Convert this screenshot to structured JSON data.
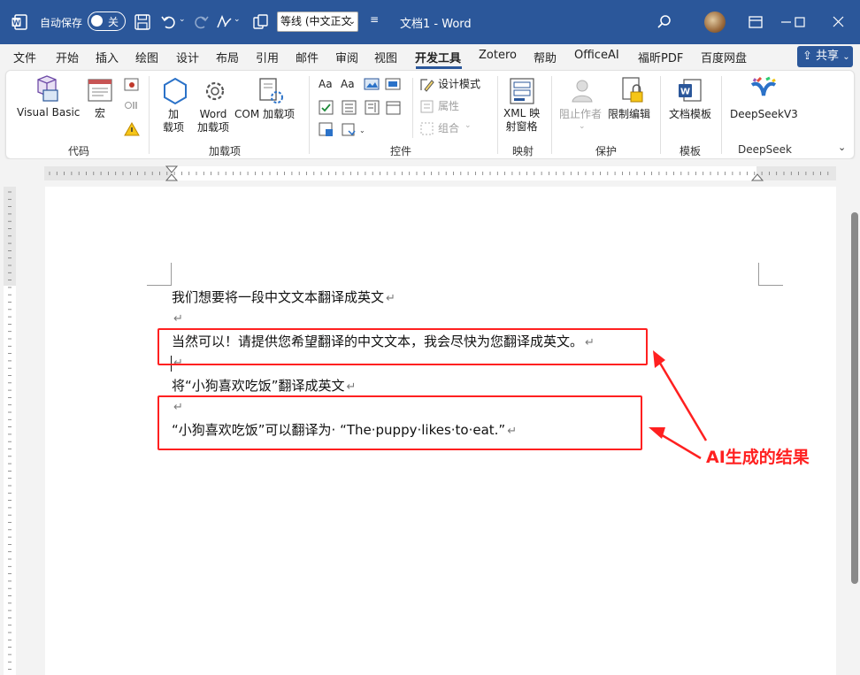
{
  "titlebar": {
    "autosave_label": "自动保存",
    "autosave_state": "关",
    "font_name": "等线 (中文正文",
    "doc_title": "文档1 - Word"
  },
  "menu": {
    "tabs": [
      "文件",
      "开始",
      "插入",
      "绘图",
      "设计",
      "布局",
      "引用",
      "邮件",
      "审阅",
      "视图",
      "开发工具",
      "Zotero",
      "帮助",
      "OfficeAI",
      "福昕PDF",
      "百度网盘"
    ],
    "share": "共享"
  },
  "ribbon": {
    "code": {
      "visual_basic": "Visual Basic",
      "macro": "宏",
      "group": "代码"
    },
    "addins": {
      "addin": "加\n载项",
      "word_addin": "Word\n加载项",
      "com_addin": "COM 加载项",
      "group": "加载项"
    },
    "controls": {
      "design_mode": "设计模式",
      "properties": "属性",
      "group_btn": "组合",
      "group": "控件"
    },
    "mapping": {
      "xml": "XML 映\n射窗格",
      "group": "映射"
    },
    "protect": {
      "block_authors": "阻止作者",
      "restrict": "限制编辑",
      "group": "保护"
    },
    "templates": {
      "doc_template": "文档模板",
      "group": "模板"
    },
    "deepseek": {
      "btn": "DeepSeekV3",
      "group": "DeepSeek"
    }
  },
  "document": {
    "lines": [
      "我们想要将一段中文文本翻译成英文",
      "",
      "当然可以！请提供您希望翻译的中文文本，我会尽快为您翻译成英文。",
      "",
      "将“小狗喜欢吃饭”翻译成英文",
      "",
      "“小狗喜欢吃饭”可以翻译为· “The·puppy·likes·to·eat.”"
    ],
    "paragraph_mark": "↵"
  },
  "annotation": {
    "text": "AI生成的结果",
    "color": "#ff2020"
  },
  "colors": {
    "titlebar": "#2b579a",
    "accent": "#2b579a"
  }
}
